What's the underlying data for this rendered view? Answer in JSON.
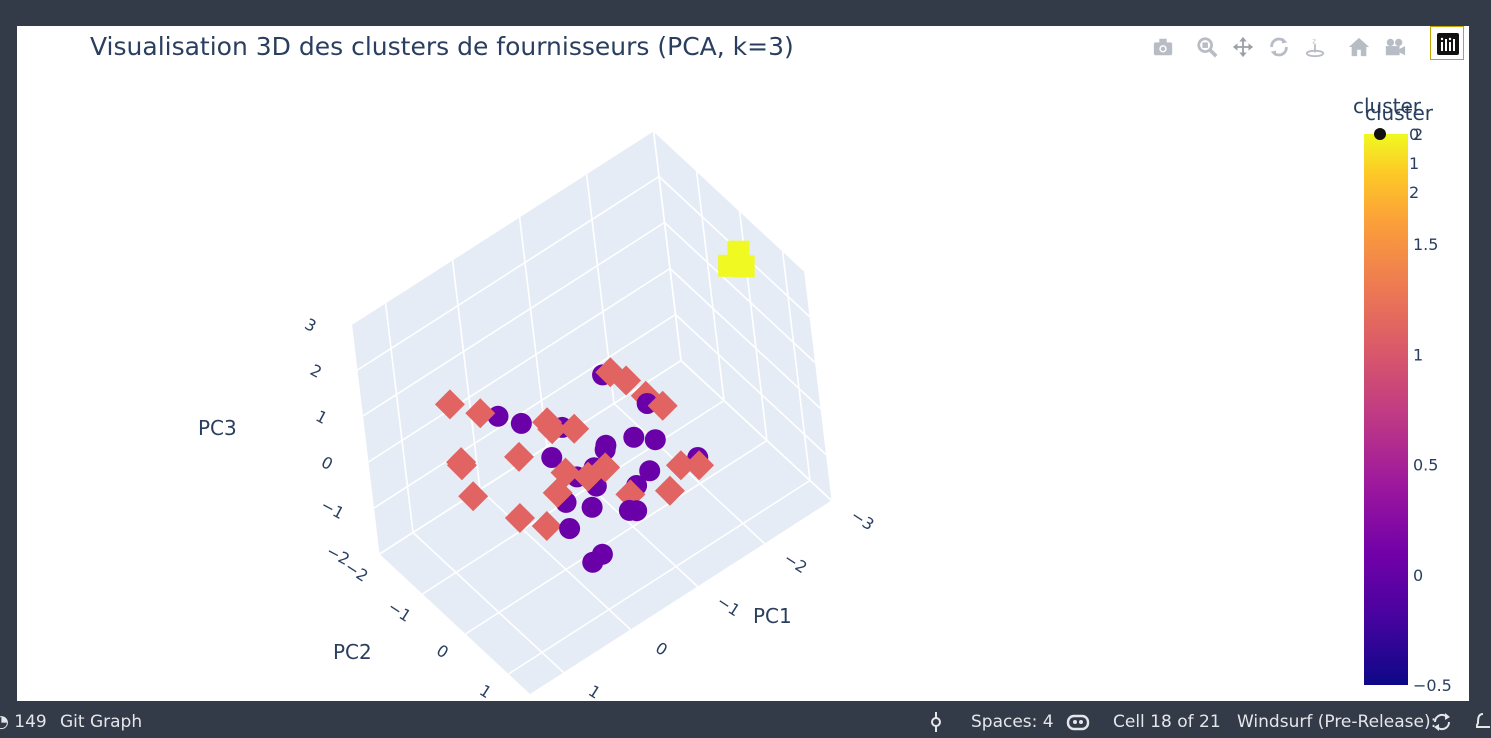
{
  "status_bar": {
    "left_count": "149",
    "git_graph": "Git Graph",
    "spaces": "Spaces: 4",
    "cell": "Cell 18 of 21",
    "windsurf": "Windsurf (Pre-Release):"
  },
  "modebar": [
    "camera-icon",
    "zoom-icon",
    "pan-icon",
    "orbit-rotation-icon",
    "turntable-icon",
    "reset-home-icon",
    "reset-camera-icon",
    "plotly-logo-icon"
  ],
  "chart_data": {
    "type": "scatter",
    "title": "Visualisation 3D des clusters de fournisseurs (PCA, k=3)",
    "xlabel": "PC1",
    "ylabel": "PC2",
    "zlabel": "PC3",
    "x_ticks": [
      "1",
      "0",
      "−1",
      "−2",
      "−3"
    ],
    "y_ticks": [
      "−2",
      "−1",
      "0",
      "1"
    ],
    "z_ticks": [
      "3",
      "2",
      "1",
      "0",
      "−1",
      "−2"
    ],
    "legend_title": "cluster",
    "legend_labels": [
      "0",
      "1",
      "2"
    ],
    "colorbar": {
      "title": "cluster",
      "ticks": [
        "2",
        "1.5",
        "1",
        "0.5",
        "0",
        "−0.5"
      ],
      "range": [
        -0.5,
        2
      ]
    },
    "series": [
      {
        "name": "0",
        "symbol": "circle",
        "color": "#6a00a8",
        "points": [
          [
            -0.5,
            0.9,
            -0.4
          ],
          [
            -0.6,
            0.9,
            -0.5
          ],
          [
            -1.0,
            0.3,
            0.2
          ],
          [
            -1.2,
            -0.7,
            0.5
          ],
          [
            0.2,
            0.6,
            -0.4
          ],
          [
            -0.2,
            0.5,
            -0.4
          ],
          [
            -0.4,
            0.3,
            -0.3
          ],
          [
            -0.8,
            0.6,
            -0.4
          ],
          [
            0.2,
            1.1,
            -0.7
          ],
          [
            0.0,
            1.0,
            -0.8
          ],
          [
            0.1,
            0.4,
            -0.1
          ],
          [
            -0.2,
            -0.4,
            -0.1
          ],
          [
            -0.6,
            0.3,
            0.4
          ],
          [
            -0.4,
            0.3,
            0.1
          ],
          [
            -0.2,
            0.2,
            0.0
          ],
          [
            -0.9,
            0.8,
            0.0
          ],
          [
            -0.1,
            -0.9,
            0.3
          ],
          [
            0.0,
            -1.3,
            0.2
          ],
          [
            -0.5,
            -0.6,
            0.1
          ],
          [
            -1.4,
            0.0,
            0.3
          ],
          [
            -1.4,
            0.1,
            -0.4
          ],
          [
            -0.9,
            -0.3,
            -0.5
          ],
          [
            -1.8,
            0.4,
            -0.9
          ]
        ]
      },
      {
        "name": "1",
        "symbol": "diamond",
        "color": "#e16462",
        "points": [
          [
            0.7,
            -1.2,
            1.2
          ],
          [
            0.4,
            -1.0,
            0.9
          ],
          [
            0.9,
            -0.7,
            0.5
          ],
          [
            0.8,
            -0.9,
            0.3
          ],
          [
            0.2,
            -0.5,
            0.2
          ],
          [
            -0.2,
            -0.3,
            0.6
          ],
          [
            -0.4,
            -0.1,
            0.6
          ],
          [
            -0.1,
            0.1,
            0.1
          ],
          [
            -0.3,
            0.3,
            0.0
          ],
          [
            -0.5,
            0.4,
            0.1
          ],
          [
            0.5,
            -0.1,
            -0.5
          ],
          [
            0.3,
            0.2,
            -0.6
          ],
          [
            -1.1,
            -0.3,
            1.0
          ],
          [
            -1.2,
            -0.1,
            0.9
          ],
          [
            -1.4,
            0.4,
            0.6
          ],
          [
            -0.7,
            0.6,
            -0.5
          ],
          [
            -1.2,
            0.7,
            -0.8
          ],
          [
            -1.5,
            0.5,
            -0.7
          ],
          [
            -1.7,
            0.6,
            -0.8
          ],
          [
            0.2,
            0.4,
            0.2
          ],
          [
            -0.3,
            -0.6,
            0.4
          ],
          [
            -1.5,
            -0.2,
            0.2
          ],
          [
            0.9,
            -0.5,
            0.0
          ]
        ]
      },
      {
        "name": "2",
        "symbol": "square",
        "color": "#f0f921",
        "points": [
          [
            -2.6,
            0.6,
            3.0
          ],
          [
            -2.5,
            0.5,
            2.7
          ],
          [
            -2.7,
            0.5,
            2.5
          ]
        ]
      }
    ]
  }
}
